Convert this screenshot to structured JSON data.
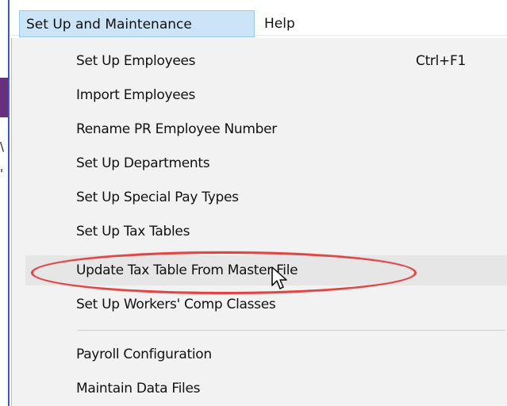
{
  "menubar": {
    "items": [
      {
        "label": "Set Up and Maintenance",
        "open": true
      },
      {
        "label": "Help",
        "open": false
      }
    ]
  },
  "background": {
    "fragments": [
      "\\",
      "'"
    ]
  },
  "dropdown": {
    "items": [
      {
        "label": "Set Up Employees",
        "shortcut": "Ctrl+F1"
      },
      {
        "label": "Import Employees",
        "shortcut": ""
      },
      {
        "label": "Rename PR Employee Number",
        "shortcut": ""
      },
      {
        "label": "Set Up Departments",
        "shortcut": ""
      },
      {
        "label": "Set Up Special Pay Types",
        "shortcut": ""
      },
      {
        "label": "Set Up Tax Tables",
        "shortcut": ""
      },
      {
        "label": "Update Tax Table From Master File",
        "shortcut": "",
        "hovered": true,
        "annotated": true
      },
      {
        "label": "Set Up Workers' Comp Classes",
        "shortcut": ""
      },
      {
        "label": "Payroll Configuration",
        "shortcut": ""
      },
      {
        "label": "Maintain Data Files",
        "shortcut": ""
      }
    ]
  },
  "colors": {
    "annotation": "#e04545",
    "menu_open_bg": "#cce4f7",
    "window_border": "#3f55c8"
  },
  "icons": {
    "cursor": "mouse-pointer-icon"
  }
}
